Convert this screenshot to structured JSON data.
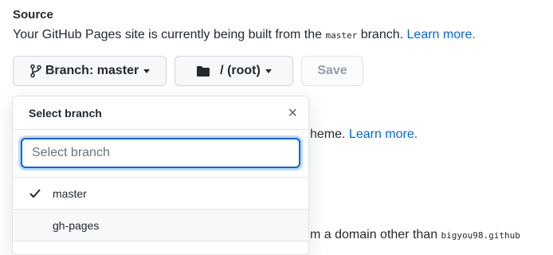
{
  "section": {
    "title": "Source",
    "desc_prefix": "Your GitHub Pages site is currently being built from the",
    "desc_branch_code": "master",
    "desc_suffix": "branch.",
    "learn_more": "Learn more."
  },
  "toolbar": {
    "branch_label": "Branch: master",
    "folder_label": "/ (root)",
    "save_label": "Save"
  },
  "behind": {
    "line1_text": "heme.",
    "line1_link": "Learn more.",
    "line2_text": "m a domain other than",
    "line2_code": "bigyou98.github"
  },
  "dropdown": {
    "title": "Select branch",
    "close_symbol": "×",
    "filter_placeholder": "Select branch",
    "items": [
      {
        "label": "master",
        "selected": true
      },
      {
        "label": "gh-pages",
        "selected": false
      }
    ]
  },
  "colors": {
    "link": "#0366d6",
    "text": "#24292e",
    "border": "#e1e4e8",
    "button_bg": "#f6f8fa"
  }
}
